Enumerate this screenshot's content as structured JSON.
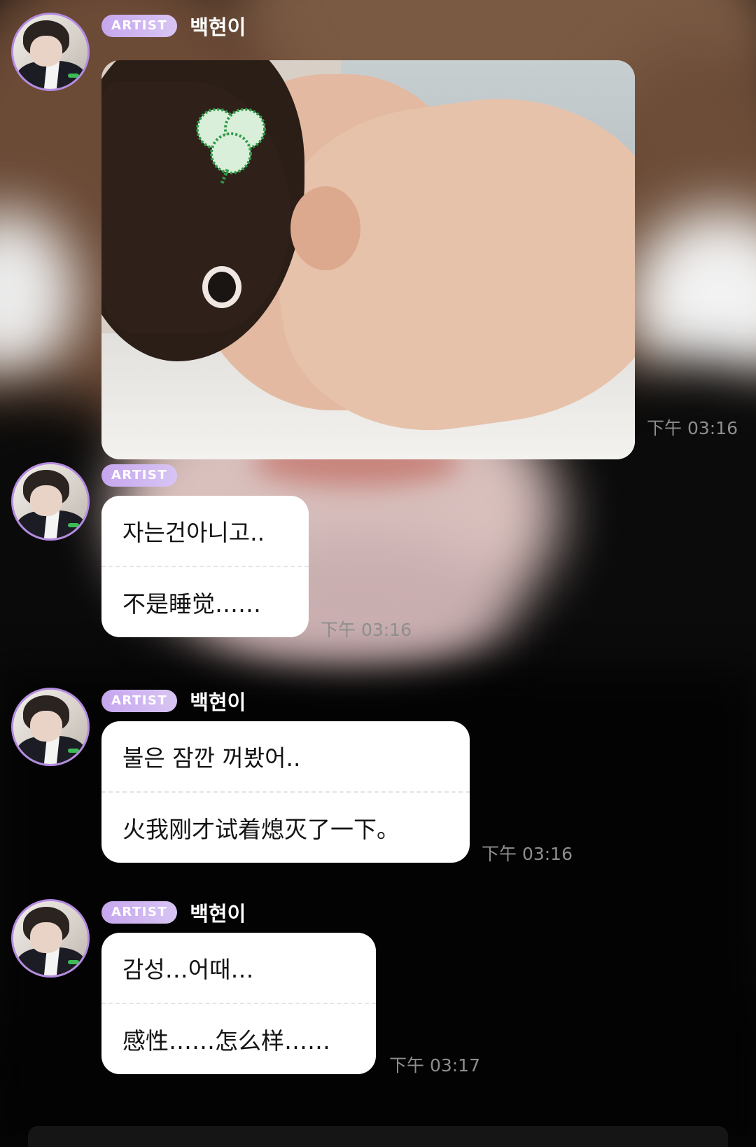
{
  "badge_label": "ARTIST",
  "sender_name": "백현이",
  "messages": [
    {
      "type": "image",
      "time": "下午 03:16"
    },
    {
      "type": "text",
      "lines": [
        "자는건아니고..",
        "不是睡觉……"
      ],
      "time": "下午 03:16"
    },
    {
      "type": "text",
      "sender": "백현이",
      "lines": [
        "불은 잠깐 꺼봤어..",
        "火我刚才试着熄灭了一下。"
      ],
      "time": "下午 03:16"
    },
    {
      "type": "text",
      "sender": "백현이",
      "lines": [
        "감성…어때…",
        "感性……怎么样……"
      ],
      "time": "下午 03:17"
    }
  ],
  "colors": {
    "badge": "#c6a6ee",
    "avatar_ring": "#b48be0",
    "bubble": "#ffffff",
    "timestamp": "#8e8e8e"
  },
  "icons": {
    "clover_sticker": "clover-sticker-icon"
  }
}
